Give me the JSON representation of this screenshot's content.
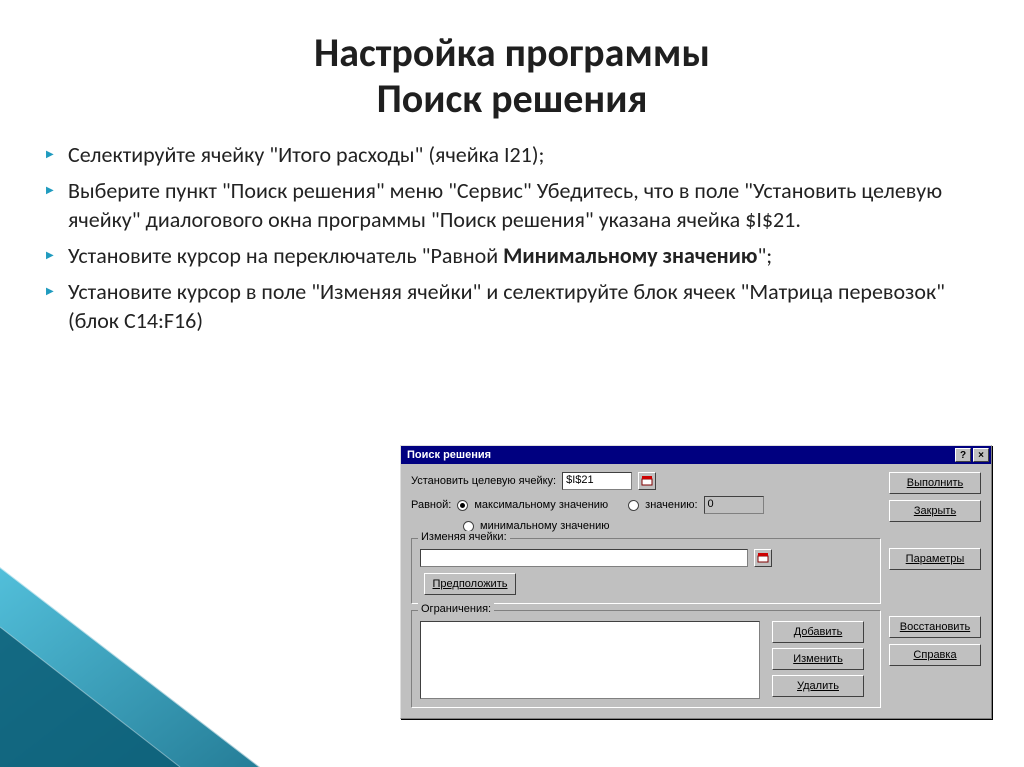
{
  "title_line1": "Настройка программы",
  "title_line2": "Поиск решения",
  "bullets": [
    "Селектируйте ячейку \"Итого расходы\" (ячейка I21);",
    "Выберите пункт \"Поиск решения\" меню \"Сервис\" Убедитесь, что в поле \"Установить целевую ячейку\" диалогового окна программы \"Поиск решения\" указана ячейка $I$21.",
    "Установите курсор на переключатель \"Равной Минимальному значению\";",
    "Установите курсор в поле \"Изменяя ячейки\" и селектируйте блок ячеек \"Матрица перевозок\" (блок C14:F16)"
  ],
  "bullet3_prefix": "Установите курсор на переключатель \"Равной ",
  "bullet3_bold": "Минимальному значению",
  "bullet3_suffix": "\";",
  "dialog": {
    "title": "Поиск решения",
    "help_btn": "?",
    "close_btn": "×",
    "target_label": "Установить целевую ячейку:",
    "target_value": "$I$21",
    "equal_label": "Равной:",
    "radio_max": "максимальному значению",
    "radio_min": "минимальному значению",
    "radio_val": "значению:",
    "value_input": "0",
    "changing_label": "Изменяя ячейки:",
    "changing_value": "",
    "constraints_label": "Ограничения:",
    "buttons": {
      "execute": "Выполнить",
      "close": "Закрыть",
      "params": "Параметры",
      "restore": "Восстановить",
      "helpref": "Справка",
      "suggest": "Предположить",
      "add": "Добавить",
      "change": "Изменить",
      "delete": "Удалить"
    }
  }
}
